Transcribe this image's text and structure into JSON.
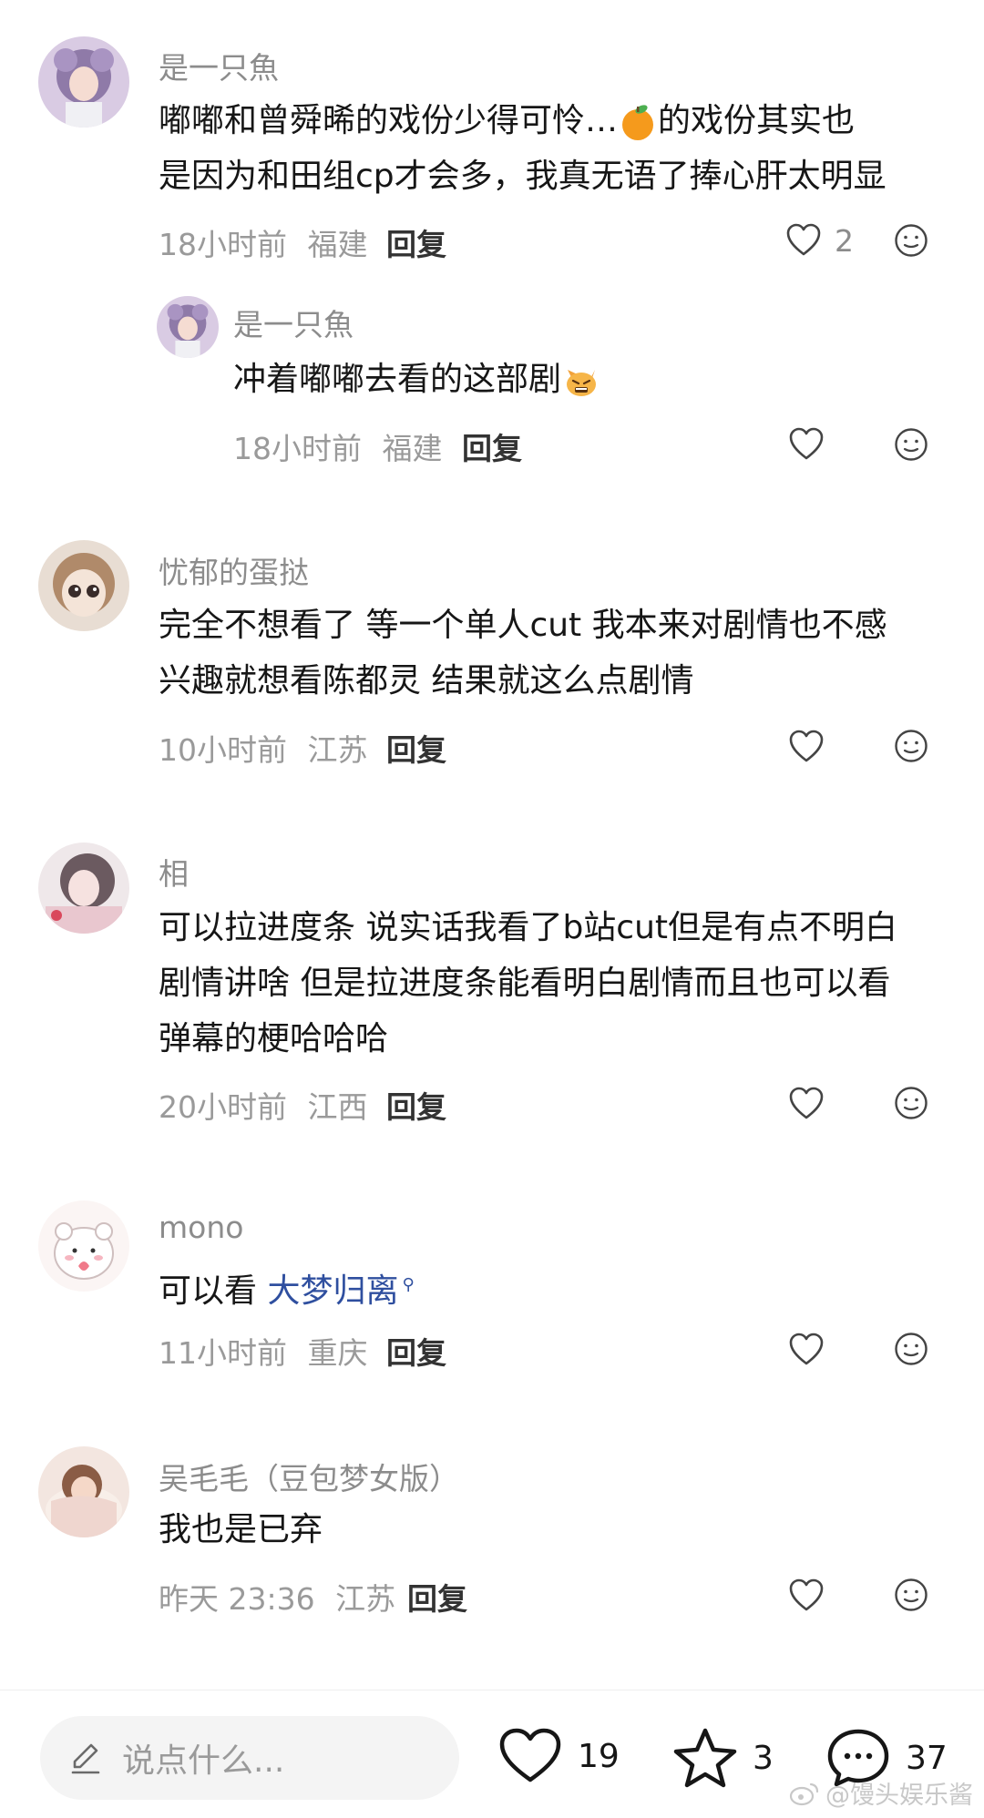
{
  "comments": [
    {
      "user": "是一只魚",
      "lines": [
        "嘟嘟和曾舜晞的戏份少得可怜…",
        "是因为和田组cp才会多，我真无语了捧心肝太明显"
      ],
      "line1_after_emoji": "的戏份其实也",
      "inline_emoji": "orange-emoji",
      "time": "18小时前",
      "location": "福建",
      "reply_label": "回复",
      "likes": "2",
      "reply": {
        "user": "是一只魚",
        "text": "冲着嘟嘟去看的这部剧",
        "inline_emoji": "angry-cat-emoji",
        "time": "18小时前",
        "location": "福建",
        "reply_label": "回复"
      }
    },
    {
      "user": "忧郁的蛋挞",
      "lines": [
        "完全不想看了 等一个单人cut 我本来对剧情也不感",
        "兴趣就想看陈都灵 结果就这么点剧情"
      ],
      "time": "10小时前",
      "location": "江苏",
      "reply_label": "回复"
    },
    {
      "user": "相",
      "lines": [
        "可以拉进度条 说实话我看了b站cut但是有点不明白",
        "剧情讲啥 但是拉进度条能看明白剧情而且也可以看",
        "弹幕的梗哈哈哈"
      ],
      "time": "20小时前",
      "location": "江西",
      "reply_label": "回复"
    },
    {
      "user": "mono",
      "text_prefix": "可以看 ",
      "link_text": "大梦归离",
      "time": "11小时前",
      "location": "重庆",
      "reply_label": "回复"
    },
    {
      "user": "吴毛毛（豆包梦女版）",
      "lines": [
        "我也是已弃"
      ],
      "time": "昨天 23:36",
      "location": "江苏",
      "reply_label": "回复"
    }
  ],
  "bottom_bar": {
    "input_placeholder": "说点什么...",
    "likes": "19",
    "favorites": "3",
    "comments": "37"
  },
  "watermark": "@馒头娱乐酱",
  "icons": {
    "like": "heart-outline-icon",
    "emoji": "emoji-face-icon",
    "edit": "pencil-icon",
    "favorite": "star-outline-icon",
    "comment": "chat-bubble-icon"
  }
}
